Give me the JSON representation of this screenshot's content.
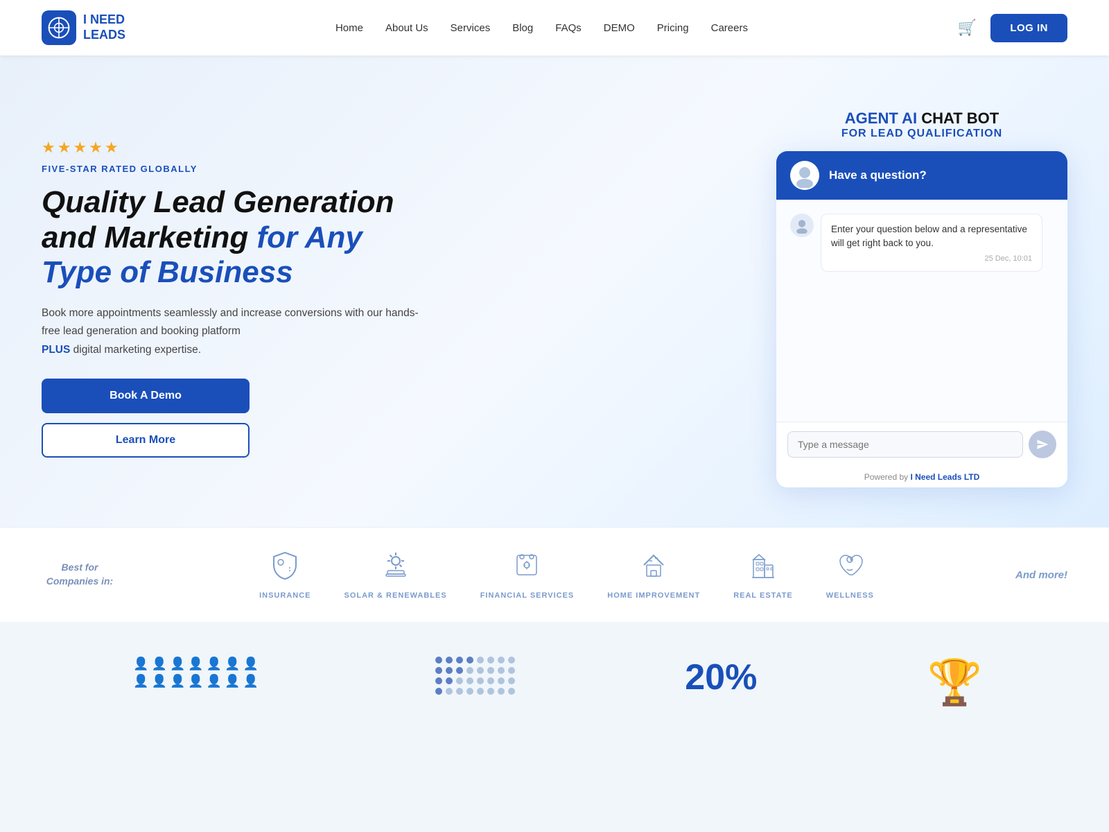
{
  "nav": {
    "logo_text_line1": "I NEED",
    "logo_text_line2": "LEADS",
    "links": [
      "Home",
      "About Us",
      "Services",
      "Blog",
      "FAQs",
      "DEMO",
      "Pricing",
      "Careers"
    ],
    "login_label": "LOG IN"
  },
  "hero": {
    "stars": "★★★★★",
    "five_star_label": "FIVE-STAR RATED GLOBALLY",
    "title_part1": "Quality Lead Generation",
    "title_part2": "and Marketing ",
    "title_part3": "for Any",
    "title_part4": "Type of Business",
    "description": "Book more appointments seamlessly and increase conversions with our hands-free lead generation and booking platform",
    "plus_text": "PLUS",
    "description2": " digital marketing expertise.",
    "btn_demo": "Book A Demo",
    "btn_learn": "Learn More"
  },
  "chatbot": {
    "label_agent": "AGENT AI ",
    "label_chat": "CHAT BOT",
    "label_sub": "FOR LEAD QUALIFICATION",
    "header_text": "Have a question?",
    "message_text": "Enter your question below and a representative will get right back to you.",
    "timestamp": "25 Dec, 10:01",
    "input_placeholder": "Type a message",
    "powered_text": "Powered by ",
    "powered_link": "I Need Leads LTD"
  },
  "industries": {
    "best_for_line1": "Best for",
    "best_for_line2": "Companies in:",
    "items": [
      {
        "name": "INSURANCE",
        "icon": "shield"
      },
      {
        "name": "SOLAR & RENEWABLES",
        "icon": "solar"
      },
      {
        "name": "FINANCIAL SERVICES",
        "icon": "finance"
      },
      {
        "name": "HOME IMPROVEMENT",
        "icon": "home"
      },
      {
        "name": "REAL ESTATE",
        "icon": "building"
      },
      {
        "name": "WELLNESS",
        "icon": "heart"
      }
    ],
    "and_more": "And more!"
  },
  "stats": {
    "percent": "20",
    "percent_symbol": "%"
  }
}
